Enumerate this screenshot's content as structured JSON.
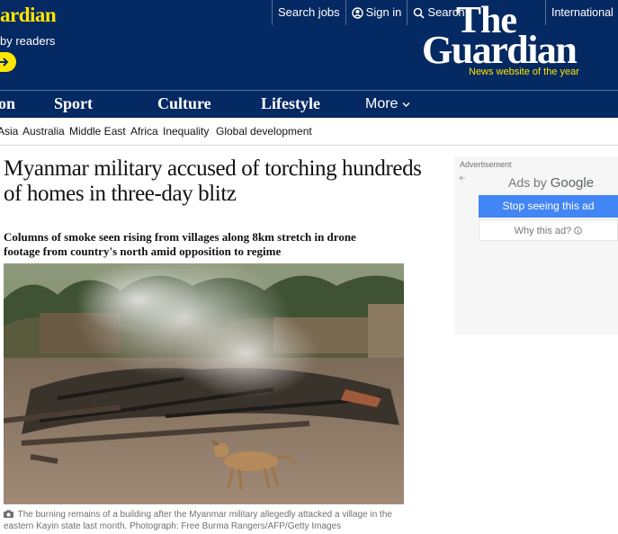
{
  "support": {
    "title": "ardian",
    "subtitle": "by readers"
  },
  "top_links": {
    "search_jobs": "Search jobs",
    "sign_in": "Sign in",
    "search": "Search",
    "edition": "International"
  },
  "logo": {
    "line1": "The",
    "line2": "Guardian",
    "award": "News website of the year"
  },
  "pillars": [
    "on",
    "Sport",
    "Culture",
    "Lifestyle",
    "More"
  ],
  "subnav": [
    "Asia",
    "Australia",
    "Middle East",
    "Africa",
    "Inequality",
    "Global development"
  ],
  "article": {
    "headline": "Myanmar military accused of torching hundreds of homes in three-day blitz",
    "standfirst": "Columns of smoke seen rising from villages along 8km stretch in drone footage from country's north amid opposition to regime",
    "caption": "The burning remains of a building after the Myanmar military allegedly attacked a village in the eastern Kayin state last month. Photograph: Free Burma Rangers/AFP/Getty Images"
  },
  "ad": {
    "label": "Advertisement",
    "ads_by": "Ads by",
    "google": "Google",
    "stop": "Stop seeing this ad",
    "why": "Why this ad?"
  },
  "colors": {
    "brand_blue": "#052962",
    "brand_yellow": "#ffe500",
    "ad_button": "#4285f4"
  }
}
